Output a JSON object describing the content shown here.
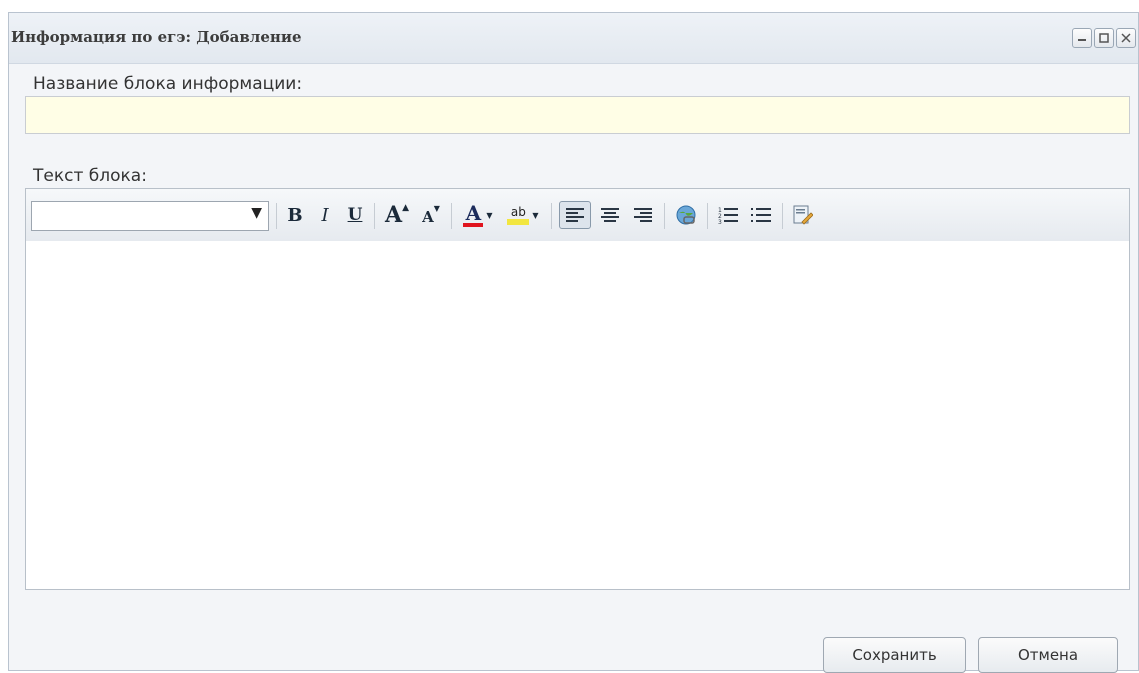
{
  "window": {
    "title": "Информация по егэ: Добавление"
  },
  "form": {
    "name_label": "Название блока информации:",
    "name_value": "",
    "text_label": "Текст блока:"
  },
  "editor_toolbar": {
    "font_select_value": "",
    "buttons": [
      {
        "icon": "bold-icon",
        "glyph": "B"
      },
      {
        "icon": "italic-icon",
        "glyph": "I"
      },
      {
        "icon": "underline-icon",
        "glyph": "U"
      },
      {
        "icon": "increase-font-icon",
        "glyph": "A"
      },
      {
        "icon": "decrease-font-icon",
        "glyph": "A"
      },
      {
        "icon": "font-color-icon",
        "glyph": "A"
      },
      {
        "icon": "highlight-color-icon",
        "glyph": "ab"
      },
      {
        "icon": "align-left-icon"
      },
      {
        "icon": "align-center-icon"
      },
      {
        "icon": "align-right-icon"
      },
      {
        "icon": "insert-link-icon"
      },
      {
        "icon": "numbered-list-icon"
      },
      {
        "icon": "bullet-list-icon"
      },
      {
        "icon": "source-edit-icon"
      }
    ]
  },
  "colors": {
    "font_color": "#e0141e",
    "highlight_color": "#f2e640",
    "input_background": "#fffee6"
  },
  "footer": {
    "save_label": "Сохранить",
    "cancel_label": "Отмена"
  }
}
